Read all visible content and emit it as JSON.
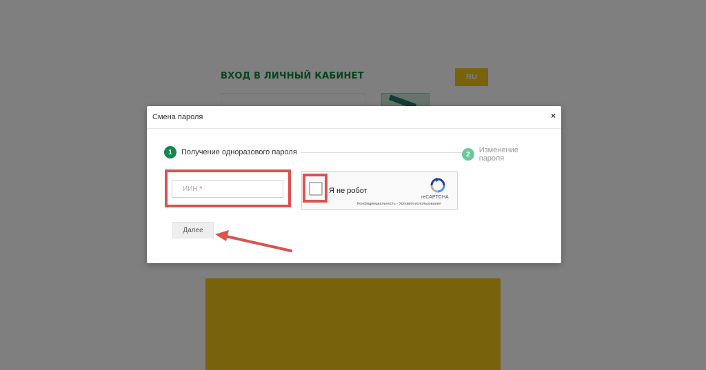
{
  "background": {
    "title": "ВХОД В ЛИЧНЫЙ КАБИНЕТ",
    "lang_button": "RU"
  },
  "modal": {
    "title": "Смена пароля",
    "close_label": "×",
    "steps": [
      {
        "number": "1",
        "label": "Получение одноразового пароля"
      },
      {
        "number": "2",
        "label": "Изменение пароля"
      }
    ],
    "iin_placeholder": "ИИН",
    "iin_required_mark": "*",
    "captcha": {
      "label": "Я не робот",
      "brand": "reCAPTCHA",
      "links": "Конфиденциальность - Условия использования"
    },
    "next_button": "Далее"
  },
  "colors": {
    "brand_green": "#0f8a3b",
    "accent_yellow": "#f0c419",
    "highlight_red": "#d9534f"
  }
}
